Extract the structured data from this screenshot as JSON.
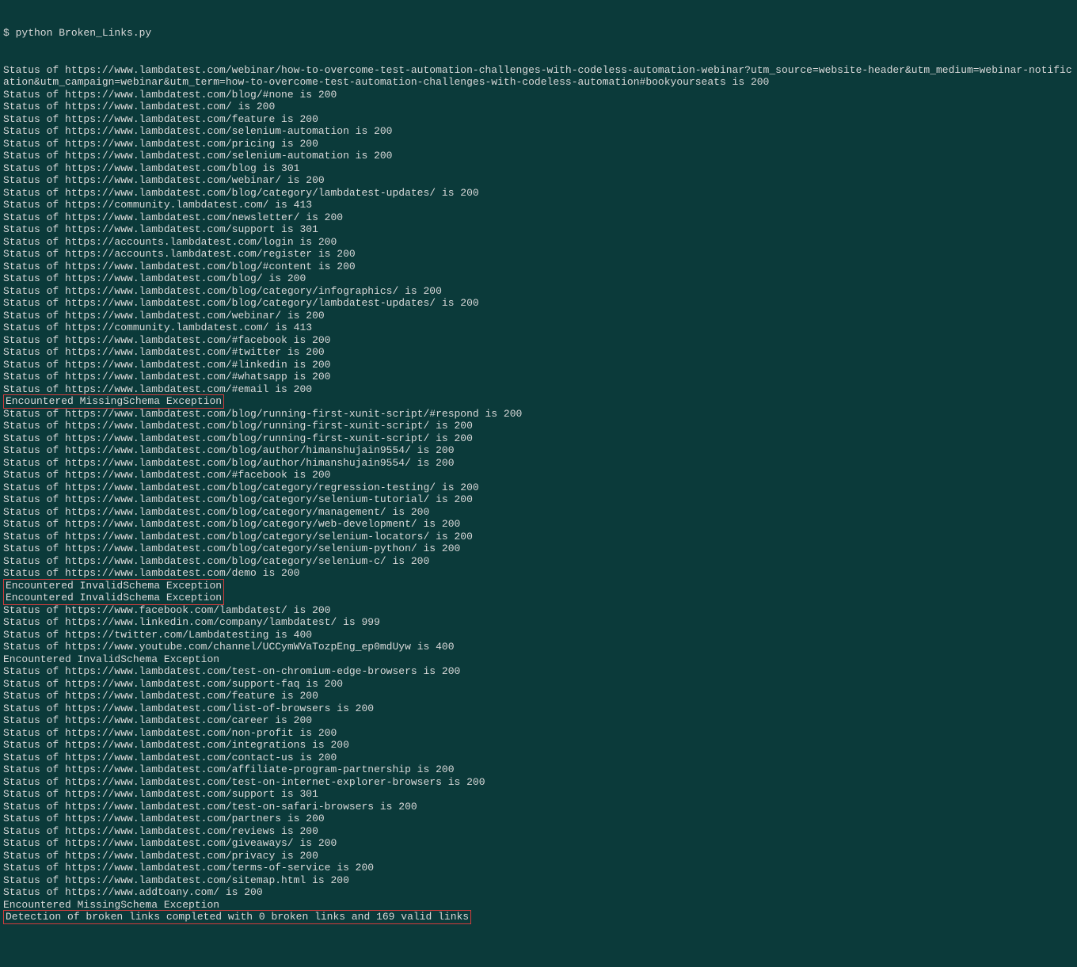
{
  "command": "$ python Broken_Links.py",
  "lines": [
    {
      "text": "Status of https://www.lambdatest.com/webinar/how-to-overcome-test-automation-challenges-with-codeless-automation-webinar?utm_source=website-header&utm_medium=webinar-notification&utm_campaign=webinar&utm_term=how-to-overcome-test-automation-challenges-with-codeless-automation#bookyourseats is 200"
    },
    {
      "text": "Status of https://www.lambdatest.com/blog/#none is 200"
    },
    {
      "text": "Status of https://www.lambdatest.com/ is 200"
    },
    {
      "text": "Status of https://www.lambdatest.com/feature is 200"
    },
    {
      "text": "Status of https://www.lambdatest.com/selenium-automation is 200"
    },
    {
      "text": "Status of https://www.lambdatest.com/pricing is 200"
    },
    {
      "text": "Status of https://www.lambdatest.com/selenium-automation is 200"
    },
    {
      "text": "Status of https://www.lambdatest.com/blog is 301"
    },
    {
      "text": "Status of https://www.lambdatest.com/webinar/ is 200"
    },
    {
      "text": "Status of https://www.lambdatest.com/blog/category/lambdatest-updates/ is 200"
    },
    {
      "text": "Status of https://community.lambdatest.com/ is 413"
    },
    {
      "text": "Status of https://www.lambdatest.com/newsletter/ is 200"
    },
    {
      "text": "Status of https://www.lambdatest.com/support is 301"
    },
    {
      "text": "Status of https://accounts.lambdatest.com/login is 200"
    },
    {
      "text": "Status of https://accounts.lambdatest.com/register is 200"
    },
    {
      "text": "Status of https://www.lambdatest.com/blog/#content is 200"
    },
    {
      "text": "Status of https://www.lambdatest.com/blog/ is 200"
    },
    {
      "text": "Status of https://www.lambdatest.com/blog/category/infographics/ is 200"
    },
    {
      "text": "Status of https://www.lambdatest.com/blog/category/lambdatest-updates/ is 200"
    },
    {
      "text": "Status of https://www.lambdatest.com/webinar/ is 200"
    },
    {
      "text": "Status of https://community.lambdatest.com/ is 413"
    },
    {
      "text": "Status of https://www.lambdatest.com/#facebook is 200"
    },
    {
      "text": "Status of https://www.lambdatest.com/#twitter is 200"
    },
    {
      "text": "Status of https://www.lambdatest.com/#linkedin is 200"
    },
    {
      "text": "Status of https://www.lambdatest.com/#whatsapp is 200"
    },
    {
      "text": "Status of https://www.lambdatest.com/#email is 200"
    },
    {
      "highlight": true,
      "text": "Encountered MissingSchema Exception"
    },
    {
      "text": "Status of https://www.lambdatest.com/blog/running-first-xunit-script/#respond is 200"
    },
    {
      "text": "Status of https://www.lambdatest.com/blog/running-first-xunit-script/ is 200"
    },
    {
      "text": "Status of https://www.lambdatest.com/blog/running-first-xunit-script/ is 200"
    },
    {
      "text": "Status of https://www.lambdatest.com/blog/author/himanshujain9554/ is 200"
    },
    {
      "text": "Status of https://www.lambdatest.com/blog/author/himanshujain9554/ is 200"
    },
    {
      "text": "Status of https://www.lambdatest.com/#facebook is 200"
    },
    {
      "text": ""
    },
    {
      "text": "Status of https://www.lambdatest.com/blog/category/regression-testing/ is 200"
    },
    {
      "text": "Status of https://www.lambdatest.com/blog/category/selenium-tutorial/ is 200"
    },
    {
      "text": "Status of https://www.lambdatest.com/blog/category/management/ is 200"
    },
    {
      "text": "Status of https://www.lambdatest.com/blog/category/web-development/ is 200"
    },
    {
      "text": "Status of https://www.lambdatest.com/blog/category/selenium-locators/ is 200"
    },
    {
      "text": "Status of https://www.lambdatest.com/blog/category/selenium-python/ is 200"
    },
    {
      "text": "Status of https://www.lambdatest.com/blog/category/selenium-c/ is 200"
    },
    {
      "text": "Status of https://www.lambdatest.com/demo is 200"
    },
    {
      "highlight": true,
      "text": "Encountered InvalidSchema Exception\nEncountered InvalidSchema Exception"
    },
    {
      "text": "Status of https://www.facebook.com/lambdatest/ is 200"
    },
    {
      "text": "Status of https://www.linkedin.com/company/lambdatest/ is 999"
    },
    {
      "text": "Status of https://twitter.com/Lambdatesting is 400"
    },
    {
      "text": "Status of https://www.youtube.com/channel/UCCymWVaTozpEng_ep0mdUyw is 400"
    },
    {
      "text": "Encountered InvalidSchema Exception"
    },
    {
      "text": "Status of https://www.lambdatest.com/test-on-chromium-edge-browsers is 200"
    },
    {
      "text": "Status of https://www.lambdatest.com/support-faq is 200"
    },
    {
      "text": "Status of https://www.lambdatest.com/feature is 200"
    },
    {
      "text": "Status of https://www.lambdatest.com/list-of-browsers is 200"
    },
    {
      "text": "Status of https://www.lambdatest.com/career is 200"
    },
    {
      "text": "Status of https://www.lambdatest.com/non-profit is 200"
    },
    {
      "text": "Status of https://www.lambdatest.com/integrations is 200"
    },
    {
      "text": "Status of https://www.lambdatest.com/contact-us is 200"
    },
    {
      "text": "Status of https://www.lambdatest.com/affiliate-program-partnership is 200"
    },
    {
      "text": "Status of https://www.lambdatest.com/test-on-internet-explorer-browsers is 200"
    },
    {
      "text": "Status of https://www.lambdatest.com/support is 301"
    },
    {
      "text": "Status of https://www.lambdatest.com/test-on-safari-browsers is 200"
    },
    {
      "text": "Status of https://www.lambdatest.com/partners is 200"
    },
    {
      "text": "Status of https://www.lambdatest.com/reviews is 200"
    },
    {
      "text": "Status of https://www.lambdatest.com/giveaways/ is 200"
    },
    {
      "text": "Status of https://www.lambdatest.com/privacy is 200"
    },
    {
      "text": "Status of https://www.lambdatest.com/terms-of-service is 200"
    },
    {
      "text": "Status of https://www.lambdatest.com/sitemap.html is 200"
    },
    {
      "text": "Status of https://www.addtoany.com/ is 200"
    },
    {
      "text": "Encountered MissingSchema Exception"
    },
    {
      "highlight": true,
      "text": "Detection of broken links completed with 0 broken links and 169 valid links"
    }
  ]
}
